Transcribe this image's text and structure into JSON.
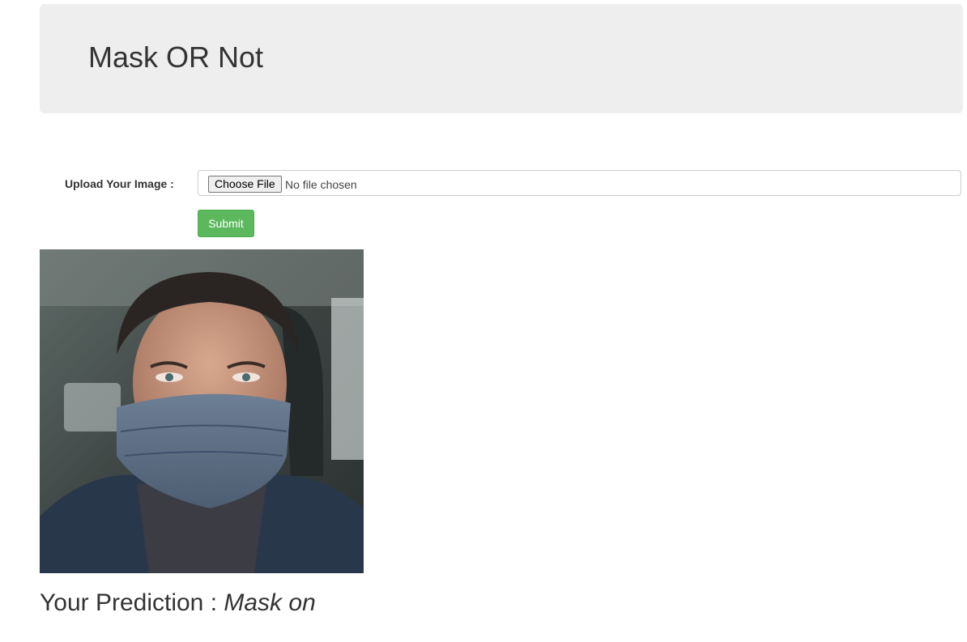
{
  "header": {
    "title": "Mask OR Not"
  },
  "form": {
    "upload_label": "Upload Your Image :",
    "choose_file_label": "Choose File",
    "file_status": "No file chosen",
    "submit_label": "Submit"
  },
  "result": {
    "prediction_label": "Your Prediction :",
    "prediction_value": "Mask on"
  },
  "colors": {
    "jumbotron_bg": "#eeeeee",
    "submit_green": "#5cb85c"
  }
}
